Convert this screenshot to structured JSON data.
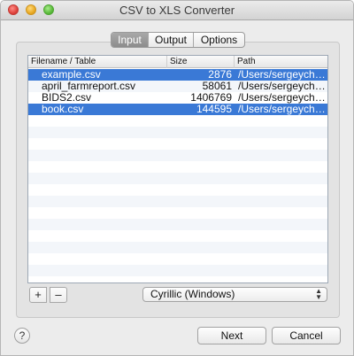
{
  "window": {
    "title": "CSV to XLS Converter"
  },
  "tabs": [
    {
      "label": "Input",
      "selected": true
    },
    {
      "label": "Output",
      "selected": false
    },
    {
      "label": "Options",
      "selected": false
    }
  ],
  "table": {
    "columns": [
      "Filename / Table",
      "Size",
      "Path"
    ],
    "rows": [
      {
        "name": "example.csv",
        "size": "2876",
        "path": "/Users/sergeyche…",
        "selected": true
      },
      {
        "name": "april_farmreport.csv",
        "size": "58061",
        "path": "/Users/sergeyche…",
        "selected": false
      },
      {
        "name": "BIDS2.csv",
        "size": "1406769",
        "path": "/Users/sergeyche…",
        "selected": false
      },
      {
        "name": "book.csv",
        "size": "144595",
        "path": "/Users/sergeyche…",
        "selected": true
      }
    ]
  },
  "controls": {
    "add_label": "+",
    "remove_label": "–",
    "encoding_selected": "Cyrillic (Windows)",
    "help_label": "?",
    "next_label": "Next",
    "cancel_label": "Cancel"
  },
  "colors": {
    "selection": "#3a79d6",
    "stripe": "#f3f6fa"
  }
}
